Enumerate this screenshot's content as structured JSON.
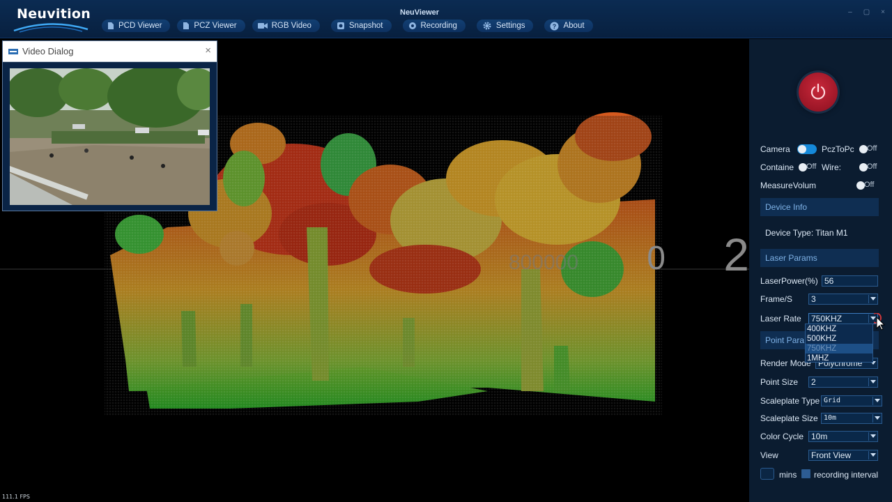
{
  "app": {
    "logo": "Neuvition",
    "title": "NeuViewer",
    "window_controls": [
      "–",
      "▢",
      "×"
    ]
  },
  "nav": [
    {
      "label": "PCD Viewer",
      "icon": "document-icon"
    },
    {
      "label": "PCZ Viewer",
      "icon": "document-icon"
    },
    {
      "label": "RGB Video",
      "icon": "video-camera-icon"
    },
    {
      "label": "Snapshot",
      "icon": "snapshot-icon"
    },
    {
      "label": "Recording",
      "icon": "record-icon"
    },
    {
      "label": "Settings",
      "icon": "gear-icon"
    },
    {
      "label": "About",
      "icon": "help-icon"
    }
  ],
  "video_dialog": {
    "title": "Video Dialog",
    "close": "×"
  },
  "view": {
    "fps": "111.1 FPS",
    "scale_label_partial": "0",
    "scale_label": "2",
    "overlay_text": "800000"
  },
  "panel": {
    "power_icon": "power-icon",
    "toggles": {
      "camera": {
        "label": "Camera",
        "state": "on"
      },
      "pcz_to_pc": {
        "label": "PczToPc",
        "state": "Off"
      },
      "container": {
        "label": "Containe",
        "state": "Off"
      },
      "wire": {
        "label": "Wire:",
        "state": "Off"
      },
      "measure_volume": {
        "label": "MeasureVolum",
        "state": "Off"
      }
    },
    "device_info": {
      "header": "Device Info",
      "device_type": "Device Type: Titan M1"
    },
    "laser_params": {
      "header": "Laser Params",
      "power_label": "LaserPower(%)",
      "power_value": "56",
      "frame_label": "Frame/S",
      "frame_value": "3",
      "rate_label": "Laser Rate",
      "rate_value": "750KHZ",
      "rate_options": [
        "400KHZ",
        "500KHZ",
        "750KHZ",
        "1MHZ"
      ]
    },
    "point_params": {
      "header": "Point Para",
      "render_label": "Render Mode",
      "render_value": "Polychrome",
      "size_label": "Point Size",
      "size_value": "2",
      "scaleplate_type_label": "Scaleplate Type",
      "scaleplate_type_value": "Grid",
      "scaleplate_size_label": "Scaleplate Size",
      "scaleplate_size_value": "10m",
      "color_cycle_label": "Color Cycle",
      "color_cycle_value": "10m",
      "view_label": "View",
      "view_value": "Front View"
    },
    "recording": {
      "mins_label": "mins",
      "interval_label": "recording interval"
    }
  }
}
